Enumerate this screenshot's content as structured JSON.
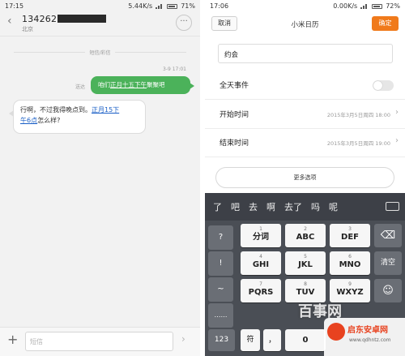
{
  "left": {
    "status": {
      "time": "17:15",
      "speed": "5.44K/s",
      "battery": "71%"
    },
    "header": {
      "title": "134262",
      "subtitle": "北京",
      "more": "···"
    },
    "category": "短信/彩信",
    "timestamp": "3-9 17:01",
    "sent_label": "送达",
    "sent": {
      "prefix": "咱们",
      "link": "正月十五下午",
      "suffix": "聚聚吧"
    },
    "received": {
      "text1": "行啊，不过我得晚点到。",
      "link1": "正月15下",
      "link2": "午6点",
      "text2": "怎么样?"
    },
    "input_placeholder": "短信",
    "plus": "+",
    "send": "›"
  },
  "right": {
    "status": {
      "time": "17:06",
      "speed": "0.00K/s",
      "battery": "72%"
    },
    "cancel": "取消",
    "title": "小米日历",
    "ok": "确定",
    "event_title": "约会",
    "rows": {
      "allday": "全天事件",
      "start_label": "开始时间",
      "start_value": "2015年3月5日周四 18:00",
      "end_label": "结束时间",
      "end_value": "2015年3月5日周四 19:00"
    },
    "more_options": "更多选项",
    "chevron": "›"
  },
  "keyboard": {
    "candidates": [
      "了",
      "吧",
      "去",
      "啊",
      "去了",
      "吗",
      "呢"
    ],
    "side": [
      "?",
      "!",
      "~",
      "……"
    ],
    "keys": [
      {
        "n": "1",
        "l": "分词"
      },
      {
        "n": "2",
        "l": "ABC"
      },
      {
        "n": "3",
        "l": "DEF"
      },
      {
        "n": "4",
        "l": "GHI"
      },
      {
        "n": "5",
        "l": "JKL"
      },
      {
        "n": "6",
        "l": "MNO"
      },
      {
        "n": "7",
        "l": "PQRS"
      },
      {
        "n": "8",
        "l": "TUV"
      },
      {
        "n": "9",
        "l": "WXYZ"
      }
    ],
    "delete": "⌫",
    "clear": "清空",
    "emoji": "☺",
    "num": "123",
    "symbol": "符",
    "comma": "，",
    "zero": "0"
  },
  "watermark": {
    "overlay": "百事网",
    "site": "启东安卓网",
    "url": "www.qdhntz.com"
  },
  "colors": {
    "accent": "#f07a1b",
    "bubble": "#4bb25a",
    "link": "#1a5fc6",
    "keyboard": "#4a4e55"
  }
}
